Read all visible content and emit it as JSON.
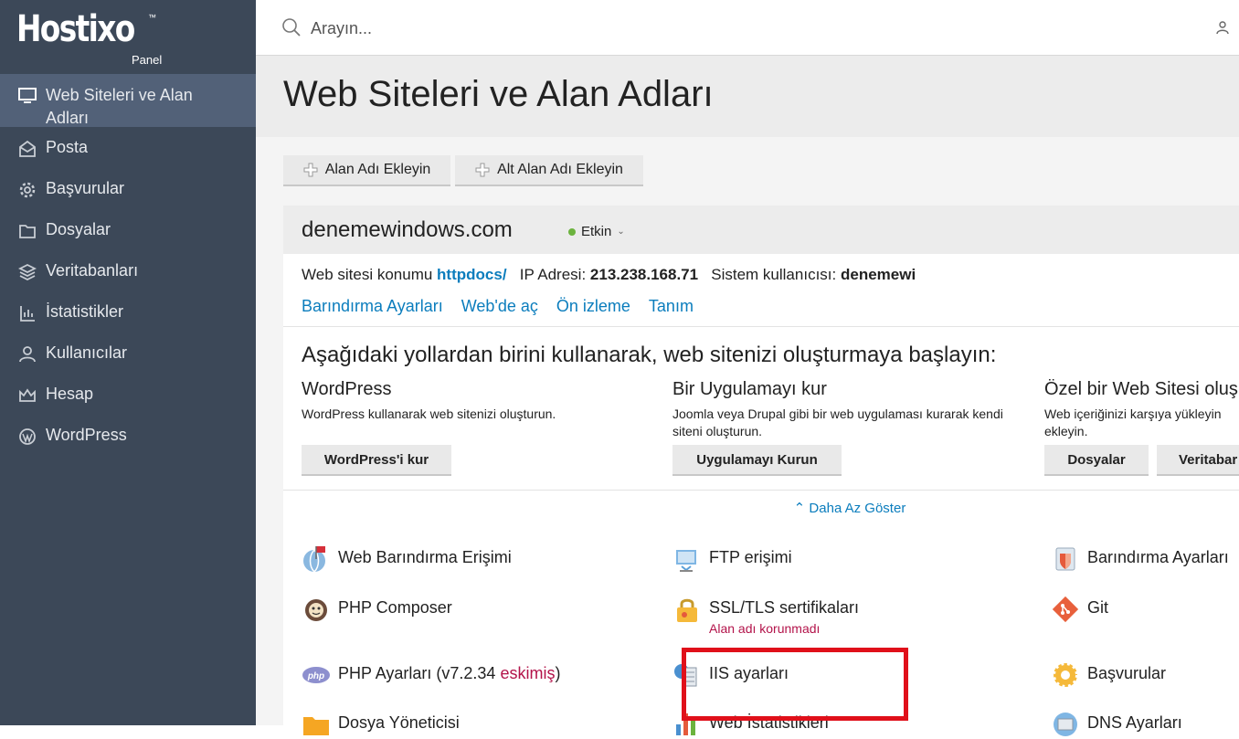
{
  "logo": {
    "text": "Hostixo",
    "tm": "™",
    "sub": "Panel"
  },
  "sidebar": {
    "items": [
      {
        "label": "Web Siteleri ve Alan Adları",
        "icon": "monitor-icon"
      },
      {
        "label": "Posta",
        "icon": "mail-icon"
      },
      {
        "label": "Başvurular",
        "icon": "gear-icon"
      },
      {
        "label": "Dosyalar",
        "icon": "folder-icon"
      },
      {
        "label": "Veritabanları",
        "icon": "database-icon"
      },
      {
        "label": "İstatistikler",
        "icon": "stats-icon"
      },
      {
        "label": "Kullanıcılar",
        "icon": "user-icon"
      },
      {
        "label": "Hesap",
        "icon": "crown-icon"
      },
      {
        "label": "WordPress",
        "icon": "wordpress-icon"
      }
    ]
  },
  "search": {
    "placeholder": "Arayın..."
  },
  "page": {
    "title": "Web Siteleri ve Alan Adları"
  },
  "toolbar": {
    "add_domain": "Alan Adı Ekleyin",
    "add_subdomain": "Alt Alan Adı Ekleyin"
  },
  "domain": {
    "name": "denemewindows.com",
    "status": "Etkin",
    "status_color": "#6cb33e",
    "location_label": "Web sitesi konumu",
    "location_value": "httpdocs/",
    "ip_label": "IP Adresi:",
    "ip_value": "213.238.168.71",
    "sysuser_label": "Sistem kullanıcısı:",
    "sysuser_value": "denemewi",
    "links": [
      "Barındırma Ayarları",
      "Web'de aç",
      "Ön izleme",
      "Tanım"
    ]
  },
  "start": {
    "title": "Aşağıdaki yollardan birini kullanarak, web sitenizi oluşturmaya başlayın:",
    "options": [
      {
        "title": "WordPress",
        "desc": "WordPress kullanarak web sitenizi oluşturun.",
        "buttons": [
          "WordPress'i kur"
        ]
      },
      {
        "title": "Bir Uygulamayı kur",
        "desc": "Joomla veya Drupal gibi bir web uygulaması kurarak kendi siteni oluşturun.",
        "buttons": [
          "Uygulamayı Kurun"
        ]
      },
      {
        "title": "Özel bir Web Sitesi oluş",
        "desc": "Web içeriğinizi karşıya yükleyin ekleyin.",
        "buttons": [
          "Dosyalar",
          "Veritabar"
        ]
      }
    ]
  },
  "show_less": "Daha Az Göster",
  "tools": {
    "web_hosting_access": "Web Barındırma Erişimi",
    "ftp": "FTP erişimi",
    "hosting_settings": "Barındırma Ayarları",
    "php_composer": "PHP Composer",
    "ssl": "SSL/TLS sertifikaları",
    "ssl_sub": "Alan adı korunmadı",
    "git": "Git",
    "php_settings": "PHP Ayarları (v7.2.34 ",
    "php_outdated": "eskimiş",
    "php_close": ")",
    "iis": "IIS ayarları",
    "applications": "Başvurular",
    "file_manager": "Dosya Yöneticisi",
    "web_stats": "Web İstatistikleri",
    "dns": "DNS Ayarları"
  },
  "colors": {
    "sidebar": "#3c4858",
    "sidebar_active": "#526178",
    "link": "#0b7dbd",
    "warning": "#b3134a",
    "highlight": "#e0101a"
  }
}
